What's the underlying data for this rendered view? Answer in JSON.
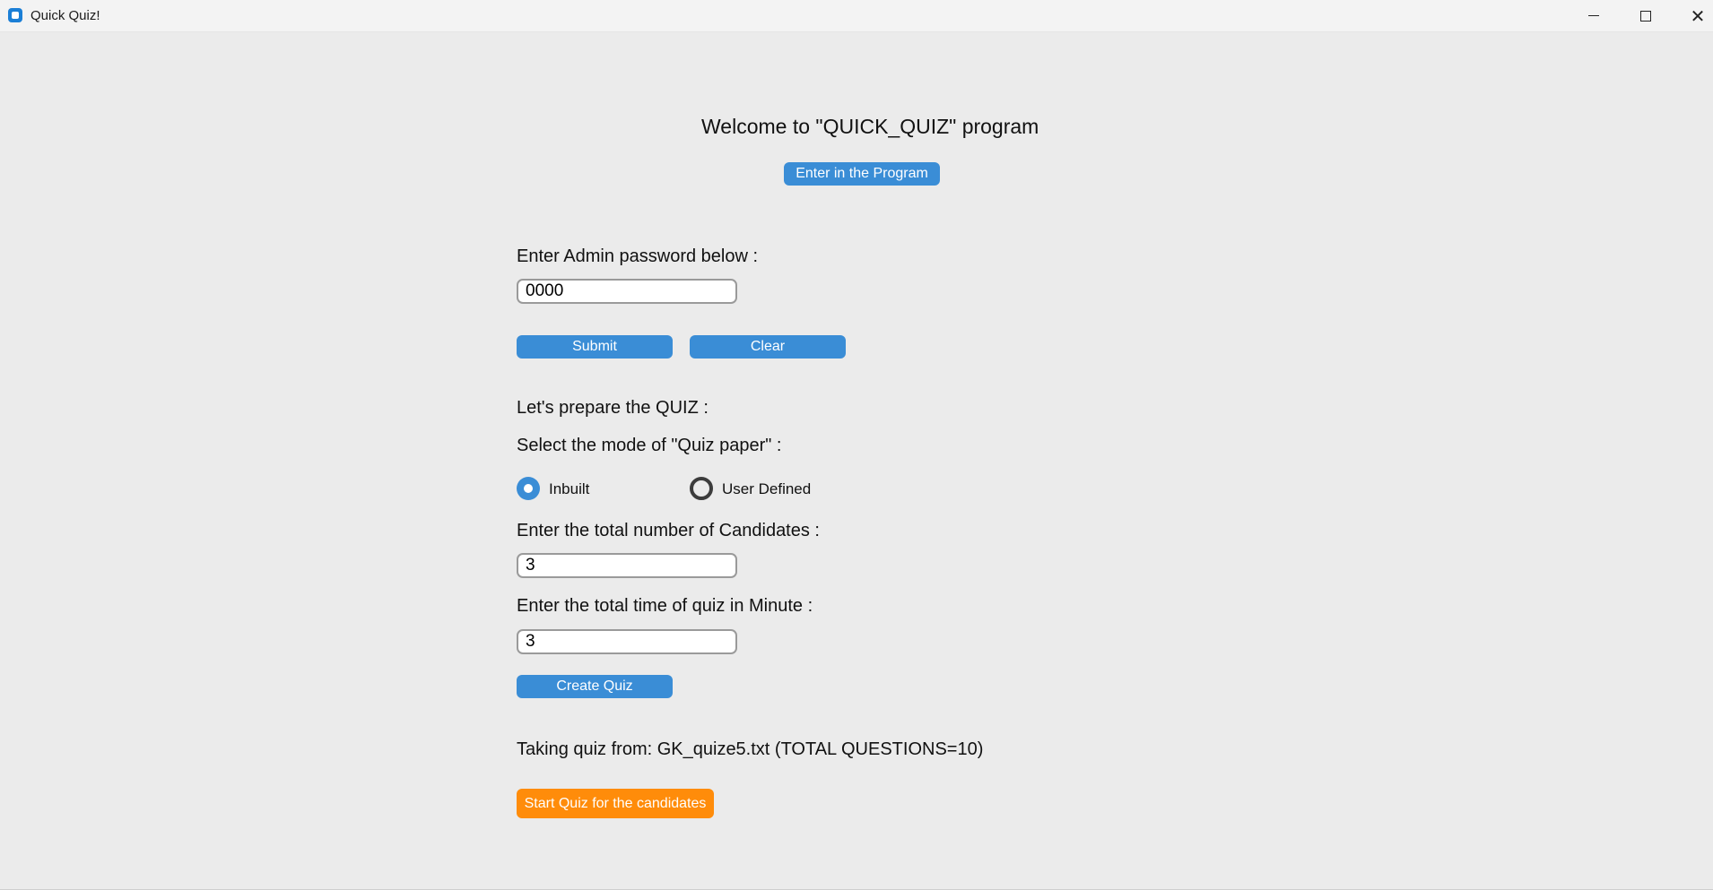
{
  "window": {
    "title": "Quick Quiz!",
    "icons": {
      "app": "app-icon",
      "minimize": "minimize-icon",
      "maximize": "maximize-icon",
      "close": "close-icon"
    }
  },
  "welcome": {
    "heading": "Welcome to \"QUICK_QUIZ\" program",
    "enter_button": "Enter in the Program"
  },
  "admin": {
    "prompt": "Enter Admin password below :",
    "password_value": "0000",
    "submit_label": "Submit",
    "clear_label": "Clear"
  },
  "prepare": {
    "heading": "Let's prepare the QUIZ :",
    "mode_prompt": "Select the mode of \"Quiz paper\" :",
    "modes": [
      {
        "label": "Inbuilt",
        "selected": true
      },
      {
        "label": "User Defined",
        "selected": false
      }
    ],
    "candidates_prompt": "Enter the total number of Candidates :",
    "candidates_value": "3",
    "time_prompt": "Enter the total time of quiz in Minute :",
    "time_value": "3",
    "create_label": "Create Quiz"
  },
  "status": {
    "source_text": "Taking quiz from: GK_quize5.txt (TOTAL QUESTIONS=10)",
    "start_label": "Start Quiz for the candidates"
  },
  "colors": {
    "accent": "#3a8dd6",
    "start_button": "#ff8c0a",
    "background": "#ebebeb"
  }
}
